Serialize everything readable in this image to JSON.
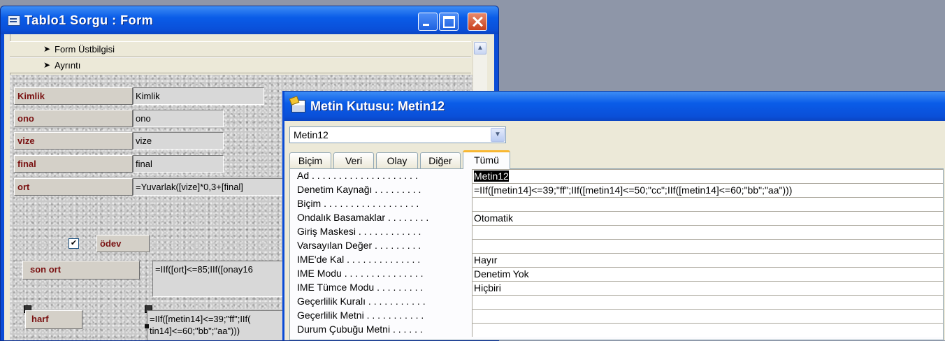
{
  "form_window": {
    "title": "Tablo1 Sorgu : Form",
    "sections": {
      "header": "Form Üstbilgisi",
      "detail": "Ayrıntı"
    },
    "controls": {
      "kimlik_label": "Kimlik",
      "kimlik_box": "Kimlik",
      "ono_label": "ono",
      "ono_box": "ono",
      "vize_label": "vize",
      "vize_box": "vize",
      "final_label": "final",
      "final_box": "final",
      "ort_label": "ort",
      "ort_box": "=Yuvarlak([vize]*0,3+[final]",
      "odev_label": "ödev",
      "odev_check": "✔",
      "son_ort_label": "son ort",
      "son_ort_box": "=IIf([ort]<=85;IIf([onay16",
      "harf_label": "harf",
      "harf_box_line1": "=IIf([metin14]<=39;\"ff\";IIf(",
      "harf_box_line2": "tin14]<=60;\"bb\";\"aa\")))"
    }
  },
  "property_sheet": {
    "title": "Metin Kutusu: Metin12",
    "object_select": "Metin12",
    "tabs": [
      "Biçim",
      "Veri",
      "Olay",
      "Diğer",
      "Tümü"
    ],
    "active_tab": "Tümü",
    "properties": [
      {
        "name": "Ad . . . . . . . . . . . . . . . . . . . .",
        "value": "Metin12"
      },
      {
        "name": "Denetim Kaynağı . . . . . . . . .",
        "value": "=IIf([metin14]<=39;\"ff\";IIf([metin14]<=50;\"cc\";IIf([metin14]<=60;\"bb\";\"aa\")))"
      },
      {
        "name": "Biçim . . . . . . . . . . . . . . . . . .",
        "value": ""
      },
      {
        "name": "Ondalık Basamaklar . . . . . . . .",
        "value": "Otomatik"
      },
      {
        "name": "Giriş Maskesi . . . . . . . . . . . .",
        "value": ""
      },
      {
        "name": "Varsayılan Değer . . . . . . . . .",
        "value": ""
      },
      {
        "name": "IME'de Kal . . . . . . . . . . . . . .",
        "value": "Hayır"
      },
      {
        "name": "IME Modu . . . . . . . . . . . . . . .",
        "value": "Denetim Yok"
      },
      {
        "name": "IME Tümce Modu . . . . . . . . .",
        "value": "Hiçbiri"
      },
      {
        "name": "Geçerlilik Kuralı . . . . . . . . . . .",
        "value": ""
      },
      {
        "name": "Geçerlilik Metni . . . . . . . . . . .",
        "value": ""
      },
      {
        "name": "Durum Çubuğu Metni . . . . . .",
        "value": ""
      }
    ]
  },
  "icons": [
    "form-window-icon",
    "minimize-icon",
    "maximize-icon",
    "close-icon",
    "section-arrow-icon",
    "scroll-up-icon",
    "property-sheet-icon",
    "chevron-down-icon",
    "checkbox-check-icon"
  ]
}
